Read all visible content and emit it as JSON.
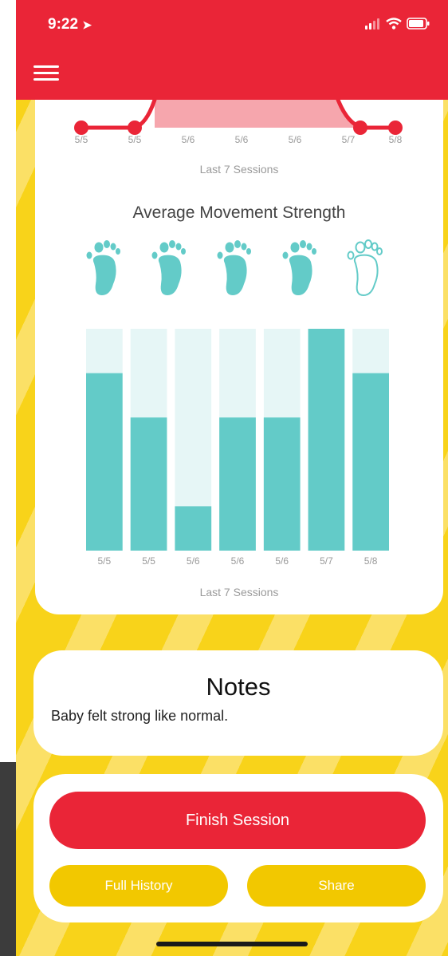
{
  "status_bar": {
    "time": "9:22",
    "location_arrow_icon": "location-arrow-icon",
    "signal_icon": "signal-icon",
    "wifi_icon": "wifi-icon",
    "battery_icon": "battery-icon"
  },
  "header": {
    "menu_icon": "hamburger-menu-icon",
    "color": "#ea2537"
  },
  "stats": {
    "line_chart": {
      "dates": [
        "5/5",
        "5/5",
        "5/6",
        "5/6",
        "5/6",
        "5/7",
        "5/8"
      ],
      "caption": "Last 7 Sessions"
    },
    "strength_title": "Average Movement Strength",
    "strength_feet": {
      "filled": 4,
      "total": 5,
      "icon": "foot-icon"
    },
    "bar_chart": {
      "dates": [
        "5/5",
        "5/5",
        "5/6",
        "5/6",
        "5/6",
        "5/7",
        "5/8"
      ],
      "caption": "Last 7 Sessions"
    }
  },
  "notes": {
    "title": "Notes",
    "text": "Baby felt strong like normal."
  },
  "actions": {
    "finish_label": "Finish Session",
    "history_label": "Full History",
    "share_label": "Share"
  },
  "colors": {
    "red": "#ea2537",
    "teal": "#63cbc8",
    "teal_light": "#e6f6f6",
    "yellow": "#f8d31a",
    "button_yellow": "#f2c800"
  },
  "chart_data": {
    "type": "bar",
    "categories": [
      "5/5",
      "5/5",
      "5/6",
      "5/6",
      "5/6",
      "5/7",
      "5/8"
    ],
    "values": [
      4,
      3,
      1,
      3,
      3,
      5,
      4
    ],
    "ylim": [
      0,
      5
    ],
    "xlabel": "Last 7 Sessions",
    "ylabel": "",
    "title": ""
  }
}
